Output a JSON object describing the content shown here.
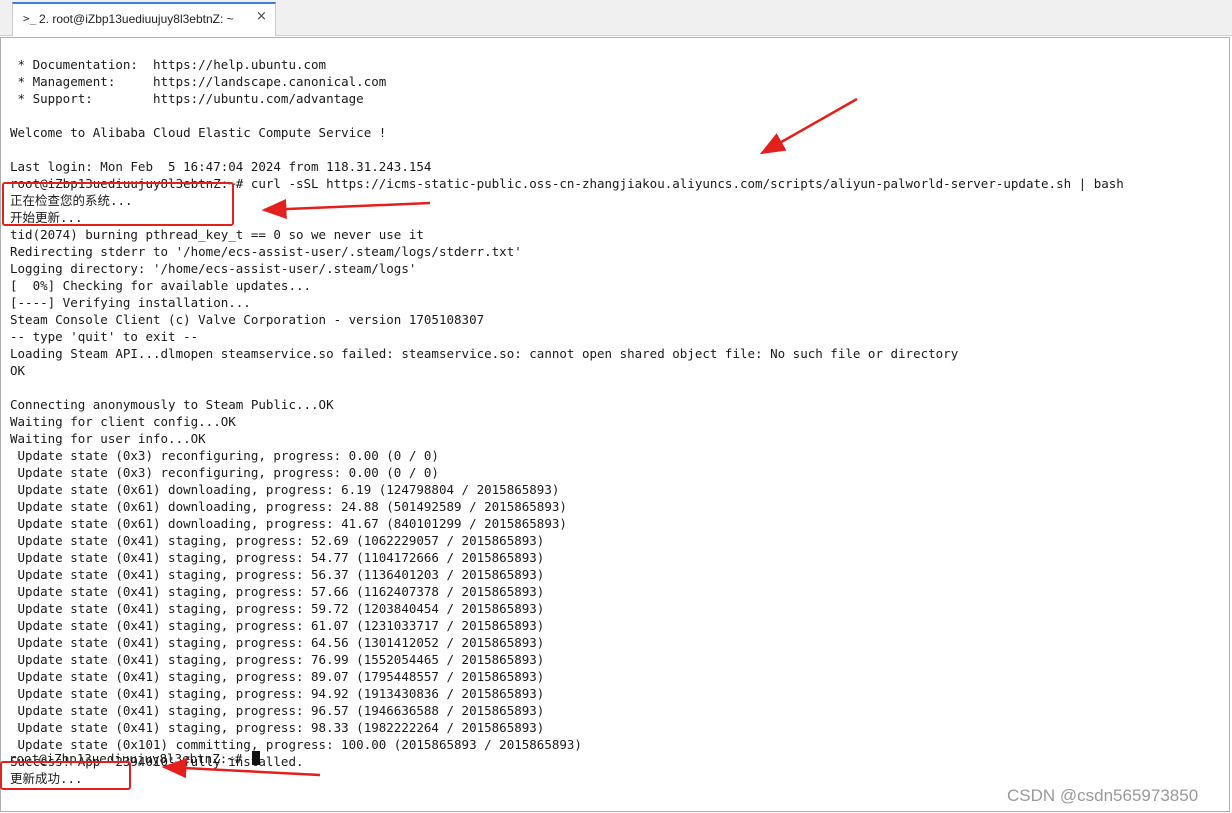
{
  "tab": {
    "icon": "terminal-icon",
    "icon_glyph": ">_",
    "title": "2. root@iZbp13uediuujuy8l3ebtnZ: ~",
    "close_glyph": "×"
  },
  "terminal": {
    "lines": [
      " * Documentation:  https://help.ubuntu.com",
      " * Management:     https://landscape.canonical.com",
      " * Support:        https://ubuntu.com/advantage",
      "",
      "Welcome to Alibaba Cloud Elastic Compute Service !",
      "",
      "Last login: Mon Feb  5 16:47:04 2024 from 118.31.243.154",
      "root@iZbp13uediuujuy8l3ebtnZ:~# curl -sSL https://icms-static-public.oss-cn-zhangjiakou.aliyuncs.com/scripts/aliyun-palworld-server-update.sh | bash",
      "正在检查您的系统...",
      "开始更新...",
      "tid(2074) burning pthread_key_t == 0 so we never use it",
      "Redirecting stderr to '/home/ecs-assist-user/.steam/logs/stderr.txt'",
      "Logging directory: '/home/ecs-assist-user/.steam/logs'",
      "[  0%] Checking for available updates...",
      "[----] Verifying installation...",
      "Steam Console Client (c) Valve Corporation - version 1705108307",
      "-- type 'quit' to exit --",
      "Loading Steam API...dlmopen steamservice.so failed: steamservice.so: cannot open shared object file: No such file or directory",
      "OK",
      "",
      "Connecting anonymously to Steam Public...OK",
      "Waiting for client config...OK",
      "Waiting for user info...OK",
      " Update state (0x3) reconfiguring, progress: 0.00 (0 / 0)",
      " Update state (0x3) reconfiguring, progress: 0.00 (0 / 0)",
      " Update state (0x61) downloading, progress: 6.19 (124798804 / 2015865893)",
      " Update state (0x61) downloading, progress: 24.88 (501492589 / 2015865893)",
      " Update state (0x61) downloading, progress: 41.67 (840101299 / 2015865893)",
      " Update state (0x41) staging, progress: 52.69 (1062229057 / 2015865893)",
      " Update state (0x41) staging, progress: 54.77 (1104172666 / 2015865893)",
      " Update state (0x41) staging, progress: 56.37 (1136401203 / 2015865893)",
      " Update state (0x41) staging, progress: 57.66 (1162407378 / 2015865893)",
      " Update state (0x41) staging, progress: 59.72 (1203840454 / 2015865893)",
      " Update state (0x41) staging, progress: 61.07 (1231033717 / 2015865893)",
      " Update state (0x41) staging, progress: 64.56 (1301412052 / 2015865893)",
      " Update state (0x41) staging, progress: 76.99 (1552054465 / 2015865893)",
      " Update state (0x41) staging, progress: 89.07 (1795448557 / 2015865893)",
      " Update state (0x41) staging, progress: 94.92 (1913430836 / 2015865893)",
      " Update state (0x41) staging, progress: 96.57 (1946636588 / 2015865893)",
      " Update state (0x41) staging, progress: 98.33 (1982222264 / 2015865893)",
      " Update state (0x101) committing, progress: 100.00 (2015865893 / 2015865893)",
      "Success! App '2394010' fully installed.",
      "更新成功..."
    ],
    "prompt": "root@iZbp13uediuujuy8l3ebtnZ:~# "
  },
  "annotations": {
    "color": "#e3201b"
  },
  "watermark": "CSDN @csdn565973850"
}
